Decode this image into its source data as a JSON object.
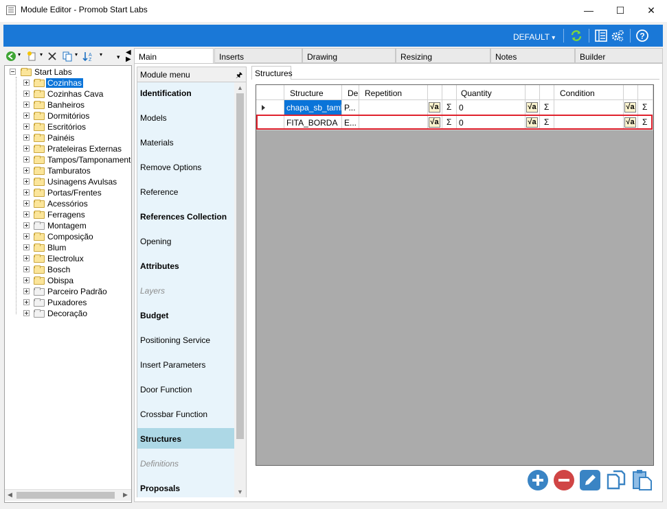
{
  "window": {
    "title": "Module Editor - Promob Start Labs",
    "minimize": "—",
    "maximize": "☐",
    "close": "✕"
  },
  "topbar": {
    "profile": "DEFAULT",
    "profile_arrow": "▾"
  },
  "tree": {
    "root": "Start Labs",
    "items": [
      {
        "label": "Cozinhas",
        "selected": true,
        "folder": "yellow"
      },
      {
        "label": "Cozinhas Cava",
        "folder": "yellow"
      },
      {
        "label": "Banheiros",
        "folder": "yellow"
      },
      {
        "label": "Dormitórios",
        "folder": "yellow"
      },
      {
        "label": "Escritórios",
        "folder": "yellow"
      },
      {
        "label": "Painéis",
        "folder": "yellow"
      },
      {
        "label": "Prateleiras Externas",
        "folder": "yellow"
      },
      {
        "label": "Tampos/Tamponamentos",
        "folder": "yellow"
      },
      {
        "label": "Tamburatos",
        "folder": "yellow"
      },
      {
        "label": "Usinagens Avulsas",
        "folder": "yellow"
      },
      {
        "label": "Portas/Frentes",
        "folder": "yellow"
      },
      {
        "label": "Acessórios",
        "folder": "yellow"
      },
      {
        "label": "Ferragens",
        "folder": "yellow"
      },
      {
        "label": "Montagem",
        "folder": "gray"
      },
      {
        "label": "Composição",
        "folder": "yellow"
      },
      {
        "label": "Blum",
        "folder": "yellow"
      },
      {
        "label": "Electrolux",
        "folder": "yellow"
      },
      {
        "label": "Bosch",
        "folder": "yellow"
      },
      {
        "label": "Obispa",
        "folder": "yellow"
      },
      {
        "label": "Parceiro Padrão",
        "folder": "gray"
      },
      {
        "label": "Puxadores",
        "folder": "gray"
      },
      {
        "label": "Decoração",
        "folder": "gray"
      }
    ]
  },
  "tabs": [
    {
      "label": "Main",
      "active": true
    },
    {
      "label": "Inserts"
    },
    {
      "label": "Drawing"
    },
    {
      "label": "Resizing"
    },
    {
      "label": "Notes"
    },
    {
      "label": "Builder"
    }
  ],
  "module_menu": {
    "title": "Module menu",
    "pin": "🖈",
    "items": [
      {
        "label": "Identification",
        "style": "bold"
      },
      {
        "label": "Models"
      },
      {
        "label": "Materials"
      },
      {
        "label": "Remove Options"
      },
      {
        "label": "Reference"
      },
      {
        "label": "References Collection",
        "style": "bold"
      },
      {
        "label": "Opening"
      },
      {
        "label": "Attributes",
        "style": "bold"
      },
      {
        "label": "Layers",
        "style": "disabled"
      },
      {
        "label": "Budget",
        "style": "bold"
      },
      {
        "label": "Positioning Service"
      },
      {
        "label": "Insert Parameters"
      },
      {
        "label": "Door Function"
      },
      {
        "label": "Crossbar Function"
      },
      {
        "label": "Structures",
        "style": "bold",
        "selected": true
      },
      {
        "label": "Definitions",
        "style": "disabled"
      },
      {
        "label": "Proposals",
        "style": "bold"
      }
    ]
  },
  "structures": {
    "tab_label": "Structures",
    "columns": {
      "structure": "Structure",
      "description": "Des",
      "repetition": "Repetition",
      "quantity": "Quantity",
      "condition": "Condition"
    },
    "formula_glyph": "√a",
    "sigma_glyph": "Σ",
    "rows": [
      {
        "structure": "chapa_sb_tamb",
        "description": "P...",
        "repetition": "",
        "quantity": "0",
        "condition": ""
      },
      {
        "structure": "FITA_BORDA",
        "description": "E...",
        "repetition": "",
        "quantity": "0",
        "condition": ""
      }
    ]
  }
}
